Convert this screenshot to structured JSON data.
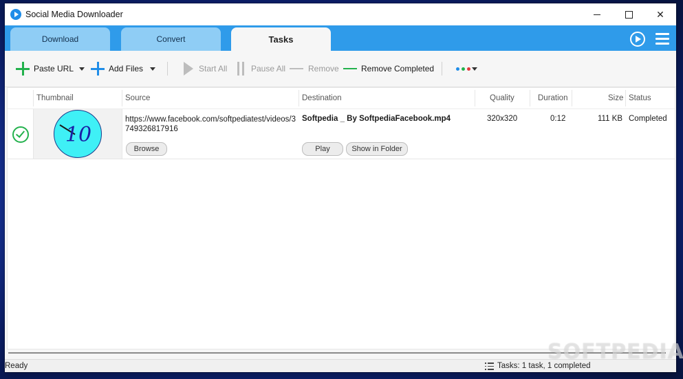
{
  "window": {
    "title": "Social Media Downloader"
  },
  "tabs": [
    {
      "label": "Download",
      "active": false
    },
    {
      "label": "Convert",
      "active": false
    },
    {
      "label": "Tasks",
      "active": true
    }
  ],
  "toolbar": {
    "paste_url": "Paste URL",
    "add_files": "Add Files",
    "start_all": "Start All",
    "pause_all": "Pause All",
    "remove": "Remove",
    "remove_completed": "Remove Completed",
    "color_dots": [
      "#1f8de8",
      "#22b14c",
      "#e03a3a"
    ]
  },
  "table": {
    "columns": {
      "thumbnail": "Thumbnail",
      "source": "Source",
      "destination": "Destination",
      "quality": "Quality",
      "duration": "Duration",
      "size": "Size",
      "status": "Status"
    },
    "rows": [
      {
        "thumbnail_number": "10",
        "source": "https://www.facebook.com/softpediatest/videos/3749326817916",
        "destination": "Softpedia _ By SoftpediaFacebook.mp4",
        "quality": "320x320",
        "duration": "0:12",
        "size": "111 KB",
        "status": "Completed",
        "browse_label": "Browse",
        "play_label": "Play",
        "show_folder_label": "Show in Folder"
      }
    ]
  },
  "statusbar": {
    "left": "Ready",
    "right": "Tasks: 1 task, 1 completed"
  },
  "watermark": "SOFTPEDIA"
}
